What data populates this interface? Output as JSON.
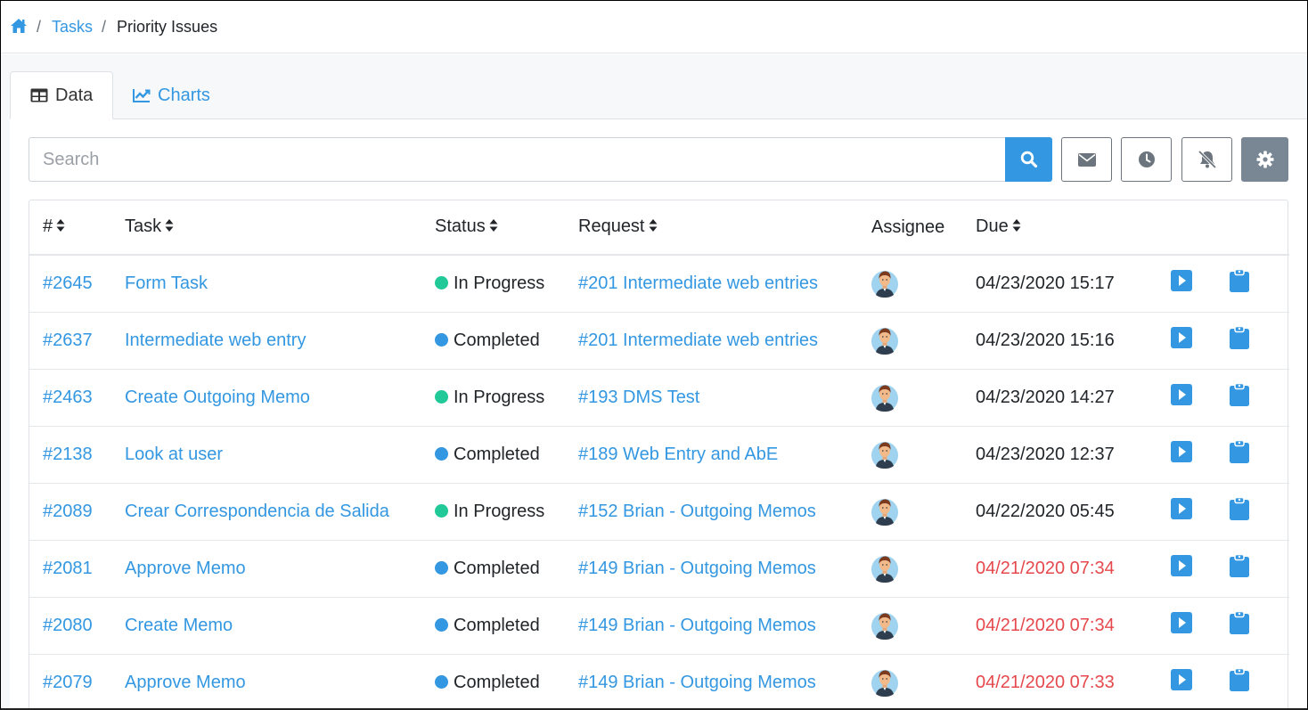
{
  "breadcrumb": {
    "home_icon": "home-icon",
    "items": [
      "Tasks",
      "Priority Issues"
    ]
  },
  "tabs": [
    {
      "label": "Data",
      "icon": "table-icon",
      "active": true
    },
    {
      "label": "Charts",
      "icon": "line-chart-icon",
      "active": false
    }
  ],
  "search": {
    "placeholder": "Search",
    "value": ""
  },
  "toolbar": {
    "buttons": [
      "search-icon",
      "envelope-icon",
      "clock-icon",
      "bell-slash-icon",
      "gear-icon"
    ]
  },
  "colors": {
    "accent": "#3397e1",
    "in_progress": "#20c997",
    "completed": "#3397e1",
    "overdue": "#e5484d"
  },
  "table": {
    "columns": [
      "#",
      "Task",
      "Status",
      "Request",
      "Assignee",
      "Due"
    ],
    "rows": [
      {
        "id": "#2645",
        "task": "Form Task",
        "status": "In Progress",
        "request": "#201 Intermediate web entries",
        "due": "04/23/2020 15:17",
        "overdue": false
      },
      {
        "id": "#2637",
        "task": "Intermediate web entry",
        "status": "Completed",
        "request": "#201 Intermediate web entries",
        "due": "04/23/2020 15:16",
        "overdue": false
      },
      {
        "id": "#2463",
        "task": "Create Outgoing Memo",
        "status": "In Progress",
        "request": "#193 DMS Test",
        "due": "04/23/2020 14:27",
        "overdue": false
      },
      {
        "id": "#2138",
        "task": "Look at user",
        "status": "Completed",
        "request": "#189 Web Entry and AbE",
        "due": "04/23/2020 12:37",
        "overdue": false
      },
      {
        "id": "#2089",
        "task": "Crear Correspondencia de Salida",
        "status": "In Progress",
        "request": "#152 Brian - Outgoing Memos",
        "due": "04/22/2020 05:45",
        "overdue": false
      },
      {
        "id": "#2081",
        "task": "Approve Memo",
        "status": "Completed",
        "request": "#149 Brian - Outgoing Memos",
        "due": "04/21/2020 07:34",
        "overdue": true
      },
      {
        "id": "#2080",
        "task": "Create Memo",
        "status": "Completed",
        "request": "#149 Brian - Outgoing Memos",
        "due": "04/21/2020 07:34",
        "overdue": true
      },
      {
        "id": "#2079",
        "task": "Approve Memo",
        "status": "Completed",
        "request": "#149 Brian - Outgoing Memos",
        "due": "04/21/2020 07:33",
        "overdue": true
      }
    ]
  }
}
